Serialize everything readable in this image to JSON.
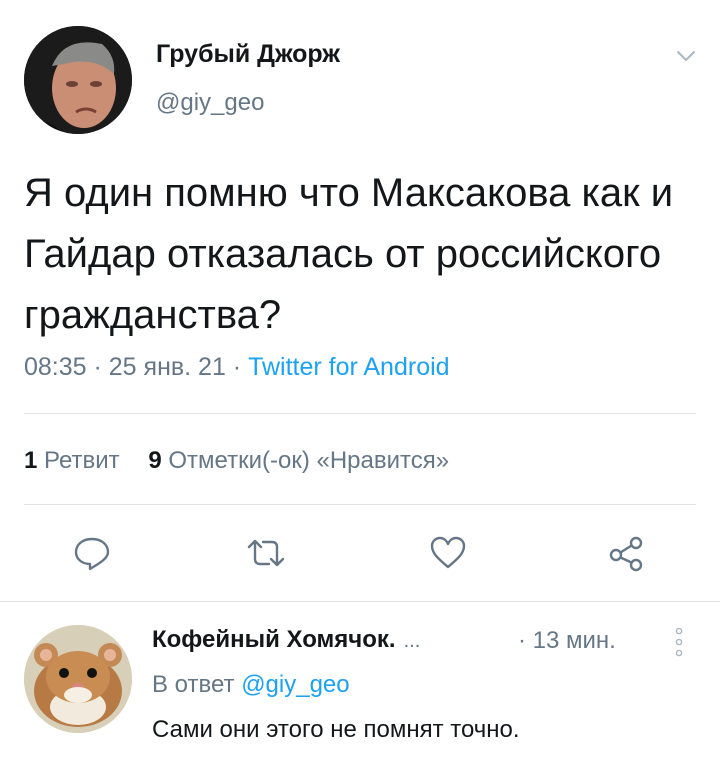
{
  "tweet": {
    "author_name": "Грубый Джорж",
    "author_handle": "@giy_geo",
    "text": "Я один помню что Максакова как и Гайдар отказалась от российского гражданства?",
    "time": "08:35",
    "sep1": " · ",
    "date": "25 янв. 21",
    "sep2": " · ",
    "source": "Twitter for Android",
    "retweet_count": "1",
    "retweet_label": "Ретвит",
    "like_count": "9",
    "like_label": "Отметки(-ок) «Нравится»"
  },
  "actions": [
    {
      "icon": "reply-icon"
    },
    {
      "icon": "retweet-icon"
    },
    {
      "icon": "like-icon"
    },
    {
      "icon": "share-icon"
    }
  ],
  "reply": {
    "author_name": "Кофейный Хомячок.",
    "ellipsis": "...",
    "time": "· 13 мин.",
    "reply_to_label": "В ответ",
    "reply_to_mention": "@giy_geo",
    "text": "Сами они этого не помнят точно."
  },
  "colors": {
    "accent": "#1da1f2",
    "secondary_text": "#657786",
    "primary_text": "#14171a",
    "divider": "#dfe3e8"
  }
}
